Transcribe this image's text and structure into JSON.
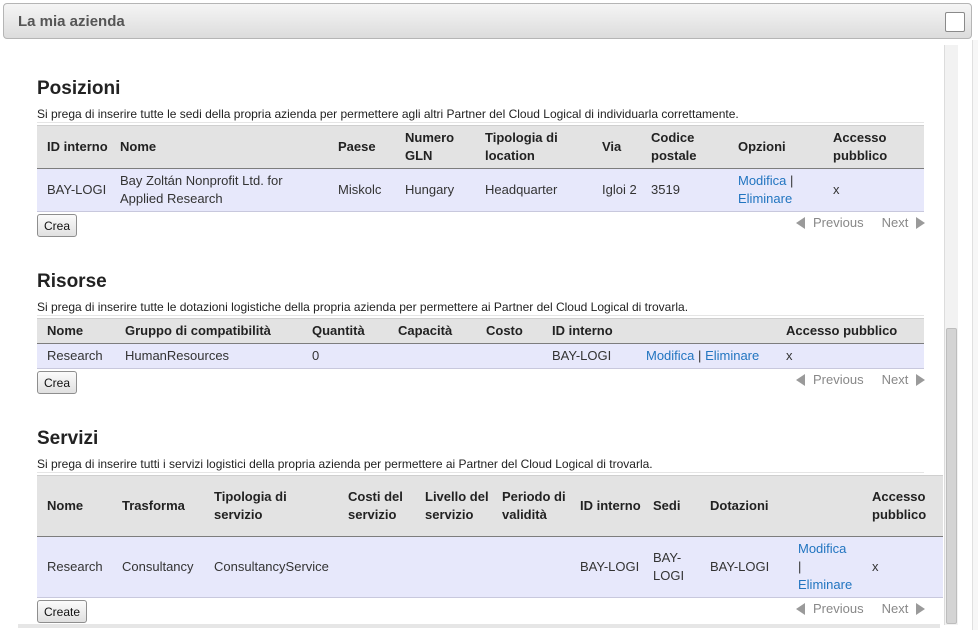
{
  "header": {
    "title": "La mia azienda"
  },
  "positions": {
    "title": "Posizioni",
    "description": "Si prega di inserire tutte le sedi della propria azienda per permettere agli altri Partner del Cloud Logical di individuarla correttamente.",
    "columns": [
      "ID interno",
      "Nome",
      "Paese",
      "Numero GLN",
      "Tipologia di location",
      "Via",
      "Codice postale",
      "Opzioni",
      "Accesso pubblico"
    ],
    "rows": [
      {
        "id": "BAY-LOGI",
        "name": "Bay Zoltán Nonprofit Ltd. for Applied Research",
        "country": "Miskolc",
        "gln": "Hungary",
        "type": "Headquarter",
        "street": "Igloi 2",
        "postal": "3519",
        "edit": "Modifica",
        "sep": "|",
        "delete": "Eliminare",
        "public": "x"
      }
    ],
    "create": "Crea"
  },
  "resources": {
    "title": "Risorse",
    "description": "Si prega di inserire tutte le dotazioni logistiche della propria azienda per permettere ai Partner del Cloud Logical di trovarla.",
    "columns": [
      "Nome",
      "Gruppo di compatibilità",
      "Quantità",
      "Capacità",
      "Costo",
      "ID interno",
      "",
      "Accesso pubblico"
    ],
    "rows": [
      {
        "name": "Research",
        "group": "HumanResources",
        "qty": "0",
        "capacity": "",
        "cost": "",
        "id": "BAY-LOGI",
        "edit": "Modifica",
        "sep": "|",
        "delete": "Eliminare",
        "public": "x"
      }
    ],
    "create": "Crea"
  },
  "services": {
    "title": "Servizi",
    "description": "Si prega di inserire tutti i servizi logistici della propria azienda per permettere ai Partner del Cloud Logical di trovarla.",
    "columns": [
      "Nome",
      "Trasforma",
      "Tipologia di servizio",
      "Costi del servizio",
      "Livello del servizio",
      "Periodo di validità",
      "ID interno",
      "Sedi",
      "Dotazioni",
      "",
      "Accesso pubblico"
    ],
    "rows": [
      {
        "name": "Research",
        "transform": "Consultancy",
        "type": "ConsultancyService",
        "cost": "",
        "level": "",
        "period": "",
        "id": "BAY-LOGI",
        "sites": "BAY-LOGI",
        "equipment": "BAY-LOGI",
        "edit": "Modifica",
        "sep": "|",
        "delete": "Eliminare",
        "public": "x"
      }
    ],
    "create": "Create"
  },
  "pager": {
    "previous": "Previous",
    "next": "Next"
  }
}
